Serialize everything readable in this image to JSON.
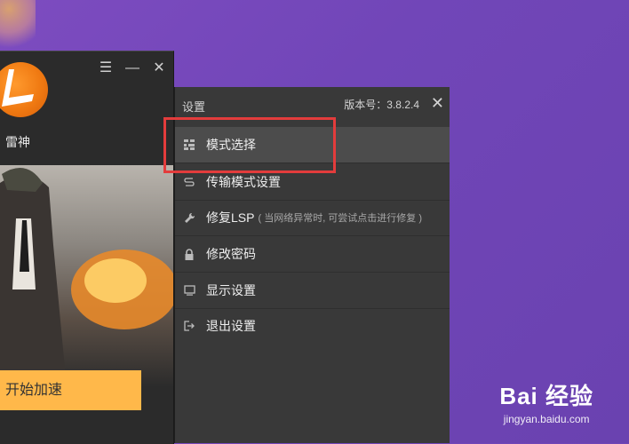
{
  "main_window": {
    "app_name": "雷神",
    "controls": {
      "menu": "☰",
      "minimize": "—",
      "close": "✕"
    },
    "start_button_label": "开始加速"
  },
  "settings": {
    "title": "设置",
    "version": "版本号：3.8.2.4",
    "close": "✕",
    "items": [
      {
        "label": "模式选择",
        "icon": "grid-icon"
      },
      {
        "label": "传输模式设置",
        "icon": "transfer-icon"
      },
      {
        "label": "修复LSP",
        "hint": "( 当网络异常时, 可尝试点击进行修复 )",
        "icon": "wrench-icon"
      },
      {
        "label": "修改密码",
        "icon": "lock-icon"
      },
      {
        "label": "显示设置",
        "icon": "monitor-icon"
      },
      {
        "label": "退出设置",
        "icon": "logout-icon"
      }
    ]
  },
  "watermark": {
    "top": "Bai 经验",
    "bottom": "jingyan.baidu.com"
  },
  "colors": {
    "accent": "#ffb84a",
    "highlight": "#e33c3c",
    "background": "#7146b8"
  }
}
